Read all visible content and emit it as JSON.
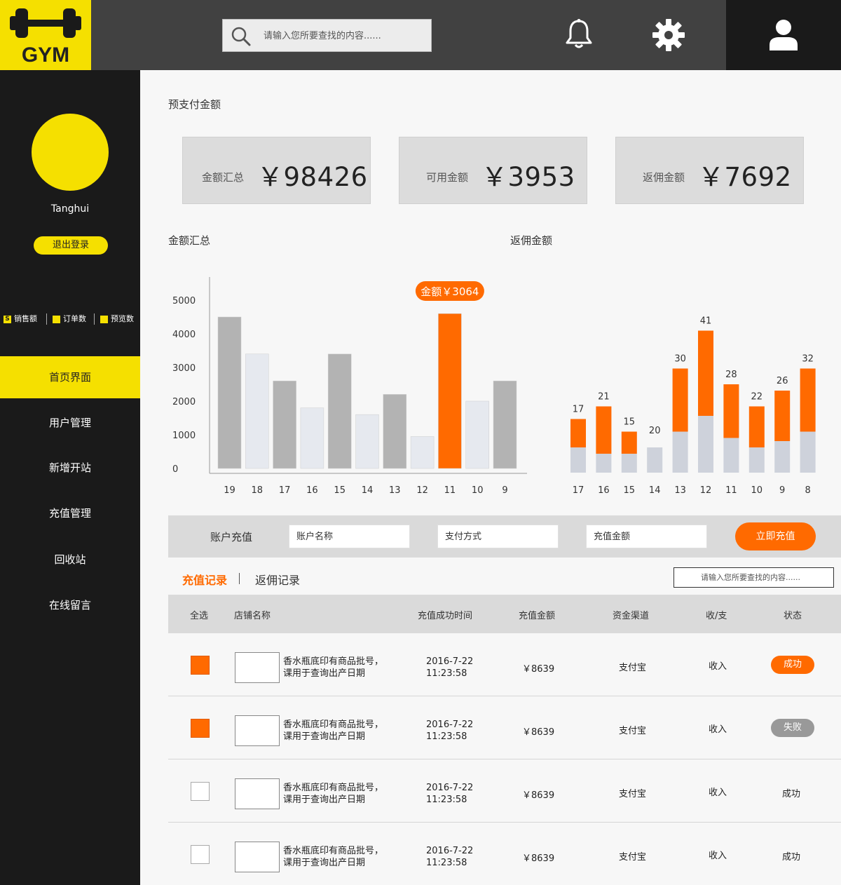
{
  "app": {
    "logo_text": "GYM"
  },
  "header": {
    "search_placeholder": "请输入您所要查找的内容......",
    "icons": [
      "search-icon",
      "bell-icon",
      "gear-icon",
      "user-icon"
    ]
  },
  "sidebar": {
    "username": "Tanghui",
    "logout_label": "退出登录",
    "stats": [
      {
        "icon": "sales-icon",
        "icon_char": "S",
        "label": "销售额"
      },
      {
        "icon": "order-icon",
        "icon_char": "",
        "label": "订单数"
      },
      {
        "icon": "preview-icon",
        "icon_char": "",
        "label": "预览数"
      }
    ],
    "nav": [
      {
        "label": "首页界面",
        "active": true
      },
      {
        "label": "用户管理",
        "active": false
      },
      {
        "label": "新增开站",
        "active": false
      },
      {
        "label": "充值管理",
        "active": false
      },
      {
        "label": "回收站",
        "active": false
      },
      {
        "label": "在线留言",
        "active": false
      }
    ]
  },
  "prepaid": {
    "title": "预支付金额",
    "cards": [
      {
        "label": "金额汇总",
        "value": "￥98426"
      },
      {
        "label": "可用金额",
        "value": "￥3953"
      },
      {
        "label": "返佣金额",
        "value": "￥7692"
      }
    ]
  },
  "colors": {
    "accent": "#ff6a00",
    "brand_yellow": "#f5e000",
    "bar_gray": "#b3b3b3",
    "bar_light": "#e6e9ef",
    "bar_base": "#ced2db"
  },
  "chart_data": [
    {
      "type": "bar",
      "title": "金额汇总",
      "categories": [
        "19",
        "18",
        "17",
        "16",
        "15",
        "14",
        "13",
        "12",
        "11",
        "10",
        "9"
      ],
      "values": [
        4500,
        3400,
        2600,
        1800,
        3400,
        1600,
        2200,
        950,
        4600,
        2000,
        2600
      ],
      "yticks": [
        0,
        1000,
        2000,
        3000,
        4000,
        5000
      ],
      "ylim": [
        0,
        5000
      ],
      "highlight_index": 8,
      "annotation": "金额￥3064"
    },
    {
      "type": "bar",
      "title": "返佣金额",
      "stacked": true,
      "categories": [
        "17",
        "16",
        "15",
        "14",
        "13",
        "12",
        "11",
        "10",
        "9",
        "8"
      ],
      "base": [
        8,
        6,
        6,
        8,
        13,
        18,
        11,
        8,
        10,
        13
      ],
      "top": [
        9,
        15,
        7,
        0,
        20,
        27,
        17,
        13,
        16,
        20
      ],
      "labels": [
        "17",
        "21",
        "15",
        "20",
        "30",
        "41",
        "28",
        "22",
        "26",
        "32"
      ]
    }
  ],
  "recharge": {
    "label": "账户充值",
    "fields": [
      {
        "name": "account-name-input",
        "placeholder": "账户名称"
      },
      {
        "name": "payment-method-input",
        "placeholder": "支付方式"
      },
      {
        "name": "amount-input",
        "placeholder": "充值金额"
      }
    ],
    "button_label": "立即充值"
  },
  "tabs": {
    "records": "充值记录",
    "rebate": "返佣记录"
  },
  "table": {
    "search_placeholder": "请输入您所要查找的内容......",
    "headers": {
      "select_all": "全选",
      "shop": "店铺名称",
      "time": "充值成功时间",
      "amount": "充值金额",
      "channel": "资金渠道",
      "type": "收/支",
      "status": "状态"
    },
    "rows": [
      {
        "checked": true,
        "shop_line1": "香水瓶底印有商品批号，",
        "shop_line2": "课用于查询出产日期",
        "date": "2016-7-22",
        "time": "11:23:58",
        "amount": "￥8639",
        "channel": "支付宝",
        "type": "收入",
        "status": "成功",
        "status_style": "ok"
      },
      {
        "checked": true,
        "shop_line1": "香水瓶底印有商品批号，",
        "shop_line2": "课用于查询出产日期",
        "date": "2016-7-22",
        "time": "11:23:58",
        "amount": "￥8639",
        "channel": "支付宝",
        "type": "收入",
        "status": "失败",
        "status_style": "fail"
      },
      {
        "checked": false,
        "shop_line1": "香水瓶底印有商品批号，",
        "shop_line2": "课用于查询出产日期",
        "date": "2016-7-22",
        "time": "11:23:58",
        "amount": "￥8639",
        "channel": "支付宝",
        "type": "收入",
        "status": "成功",
        "status_style": "plain"
      },
      {
        "checked": false,
        "shop_line1": "香水瓶底印有商品批号，",
        "shop_line2": "课用于查询出产日期",
        "date": "2016-7-22",
        "time": "11:23:58",
        "amount": "￥8639",
        "channel": "支付宝",
        "type": "收入",
        "status": "成功",
        "status_style": "plain"
      }
    ]
  }
}
